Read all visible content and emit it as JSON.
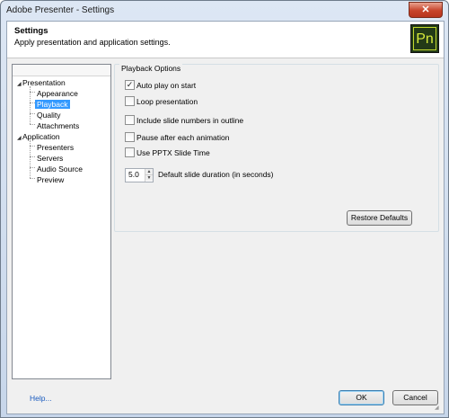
{
  "window": {
    "title": "Adobe Presenter - Settings",
    "close_label": "✕"
  },
  "header": {
    "title": "Settings",
    "subtitle": "Apply presentation and application settings.",
    "logo_text": "Pn"
  },
  "tree": {
    "nodes": [
      {
        "label": "Presentation",
        "expanded": true
      },
      {
        "label": "Appearance"
      },
      {
        "label": "Playback",
        "selected": true
      },
      {
        "label": "Quality"
      },
      {
        "label": "Attachments"
      },
      {
        "label": "Application",
        "expanded": true
      },
      {
        "label": "Presenters"
      },
      {
        "label": "Servers"
      },
      {
        "label": "Audio Source"
      },
      {
        "label": "Preview"
      }
    ]
  },
  "playback": {
    "group_label": "Playback Options",
    "options": [
      {
        "label": "Auto play on start",
        "checked": true
      },
      {
        "label": "Loop presentation",
        "checked": false
      },
      {
        "label": "Include slide numbers in outline",
        "checked": false
      },
      {
        "label": "Pause after each animation",
        "checked": false
      },
      {
        "label": "Use PPTX  Slide Time",
        "checked": false
      }
    ],
    "duration_value": "5.0",
    "duration_label": "Default slide duration (in seconds)",
    "restore_label": "Restore Defaults"
  },
  "footer": {
    "help_label": "Help...",
    "ok_label": "OK",
    "cancel_label": "Cancel"
  }
}
